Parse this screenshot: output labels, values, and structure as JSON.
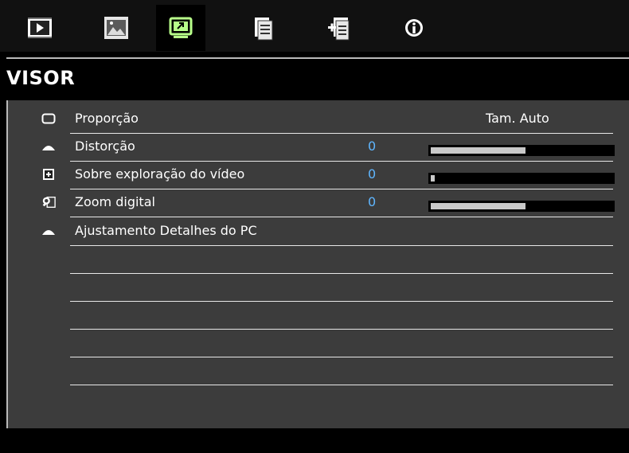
{
  "tabs": [
    {
      "icon": "image-play-icon",
      "active": false
    },
    {
      "icon": "picture-settings-icon",
      "active": false
    },
    {
      "icon": "display-screen-icon",
      "active": true
    },
    {
      "icon": "document-settings-icon",
      "active": false
    },
    {
      "icon": "document-plus-icon",
      "active": false
    },
    {
      "icon": "info-icon",
      "active": false
    }
  ],
  "header": {
    "title": "VISOR"
  },
  "menu": {
    "items": [
      {
        "label": "Proporção",
        "icon": "aspect-ratio-icon",
        "option": "Tam. Auto"
      },
      {
        "label": "Distorção",
        "icon": "keystone-triangle-icon",
        "value": "0",
        "level": 0.52
      },
      {
        "label": "Sobre exploração do vídeo",
        "icon": "overscan-icon",
        "value": "0",
        "level": 0.02
      },
      {
        "label": "Zoom digital",
        "icon": "digital-zoom-icon",
        "value": "0",
        "level": 0.52
      },
      {
        "label": "Ajustamento Detalhes do PC",
        "icon": "pc-detail-triangle-icon"
      }
    ]
  },
  "colors": {
    "value_blue": "#5fb6ff",
    "panel_gray": "#3c3c3c",
    "bar_fill": "#c9c9c9"
  }
}
